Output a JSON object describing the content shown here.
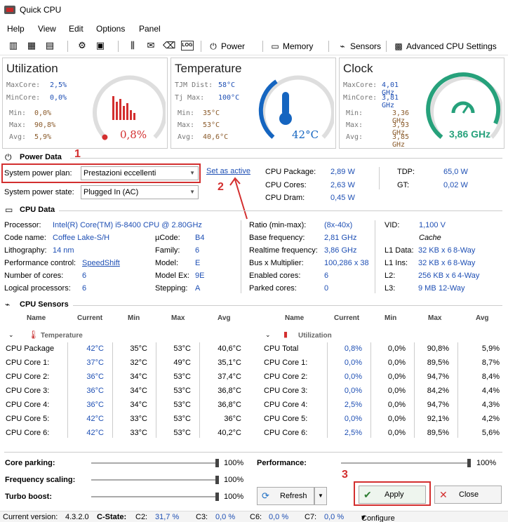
{
  "window": {
    "title": "Quick CPU"
  },
  "menu": [
    "Help",
    "View",
    "Edit",
    "Options",
    "Panel"
  ],
  "toolbar": {
    "power": "Power",
    "memory": "Memory",
    "sensors": "Sensors",
    "advanced": "Advanced CPU Settings",
    "log_icon": "LOG"
  },
  "utilization": {
    "title": "Utilization",
    "maxcore_label": "MaxCore:",
    "maxcore": "2,5%",
    "mincore_label": "MinCore:",
    "mincore": "0,0%",
    "min_label": "Min:",
    "min": "0,0%",
    "max_label": "Max:",
    "max": "90,8%",
    "avg_label": "Avg:",
    "avg": "5,9%",
    "value": "0,8%",
    "level": 0.008
  },
  "temperature": {
    "title": "Temperature",
    "tjm_label": "TJM Dist:",
    "tjm": "58°C",
    "tjmax_label": "Tj Max:",
    "tjmax": "100°C",
    "min_label": "Min:",
    "min": "35°C",
    "max_label": "Max:",
    "max": "53°C",
    "avg_label": "Avg:",
    "avg": "40,6°C",
    "value": "42°C",
    "level": 0.42
  },
  "clock": {
    "title": "Clock",
    "maxcore_label": "MaxCore:",
    "maxcore": "4,01 GHz",
    "mincore_label": "MinCore:",
    "mincore": "3,81 GHz",
    "min_label": "Min:",
    "min": "3,36 GHz",
    "max_label": "Max:",
    "max": "3,93 GHz",
    "avg_label": "Avg:",
    "avg": "3,85 GHz",
    "value": "3,86 GHz",
    "level": 0.9
  },
  "power_data": {
    "heading": "Power Data",
    "plan_label": "System power plan:",
    "plan_value": "Prestazioni eccellenti",
    "set_active": "Set as active",
    "state_label": "System power state:",
    "state_value": "Plugged In (AC)",
    "pkg_label": "CPU Package:",
    "pkg": "2,89 W",
    "cores_label": "CPU Cores:",
    "cores": "2,63 W",
    "dram_label": "CPU Dram:",
    "dram": "0,45 W",
    "tdp_label": "TDP:",
    "tdp": "65,0 W",
    "gt_label": "GT:",
    "gt": "0,02 W"
  },
  "annotations": {
    "one": "1",
    "two": "2",
    "three": "3"
  },
  "cpu_data": {
    "heading": "CPU Data",
    "processor_label": "Processor:",
    "processor": "Intel(R) Core(TM) i5-8400 CPU @ 2.80GHz",
    "codename_label": "Code name:",
    "codename": "Coffee Lake-S/H",
    "litho_label": "Lithography:",
    "litho": "14 nm",
    "perf_label": "Performance control:",
    "perf": "SpeedShift",
    "ncores_label": "Number of cores:",
    "ncores": "6",
    "nlogical_label": "Logical processors:",
    "nlogical": "6",
    "ucode_label": "µCode:",
    "ucode": "B4",
    "family_label": "Family:",
    "family": "6",
    "model_label": "Model:",
    "model": "E",
    "modelex_label": "Model Ex:",
    "modelex": "9E",
    "stepping_label": "Stepping:",
    "stepping": "A",
    "ratio_label": "Ratio (min-max):",
    "ratio": "(8x-40x)",
    "basefreq_label": "Base frequency:",
    "basefreq": "2,81 GHz",
    "rtfreq_label": "Realtime frequency:",
    "rtfreq": "3,86 GHz",
    "bus_label": "Bus x Multiplier:",
    "bus": "100,286 x 38",
    "enabled_label": "Enabled cores:",
    "enabled": "6",
    "parked_label": "Parked cores:",
    "parked": "0",
    "vid_label": "VID:",
    "vid": "1,100 V",
    "cache_label": "Cache",
    "l1d_label": "L1 Data:",
    "l1d": "32 KB x 6",
    "l1d_way": "8-Way",
    "l1i_label": "L1 Ins:",
    "l1i": "32 KB x 6",
    "l1i_way": "8-Way",
    "l2_label": "L2:",
    "l2": "256 KB x 6",
    "l2_way": "4-Way",
    "l3_label": "L3:",
    "l3": "9 MB",
    "l3_way": "12-Way"
  },
  "sensors": {
    "heading": "CPU Sensors",
    "cols": [
      "Name",
      "Current",
      "Min",
      "Max",
      "Avg"
    ],
    "temp_group": "Temperature",
    "util_group": "Utilization",
    "temp_rows": [
      [
        "CPU Package",
        "42°C",
        "35°C",
        "53°C",
        "40,6°C"
      ],
      [
        "CPU Core 1:",
        "37°C",
        "32°C",
        "49°C",
        "35,1°C"
      ],
      [
        "CPU Core 2:",
        "36°C",
        "34°C",
        "53°C",
        "37,4°C"
      ],
      [
        "CPU Core 3:",
        "36°C",
        "34°C",
        "53°C",
        "36,8°C"
      ],
      [
        "CPU Core 4:",
        "36°C",
        "34°C",
        "53°C",
        "36,8°C"
      ],
      [
        "CPU Core 5:",
        "42°C",
        "33°C",
        "53°C",
        "36°C"
      ],
      [
        "CPU Core 6:",
        "42°C",
        "33°C",
        "53°C",
        "40,2°C"
      ]
    ],
    "util_rows": [
      [
        "CPU Total",
        "0,8%",
        "0,0%",
        "90,8%",
        "5,9%"
      ],
      [
        "CPU Core 1:",
        "0,0%",
        "0,0%",
        "89,5%",
        "8,7%"
      ],
      [
        "CPU Core 2:",
        "0,0%",
        "0,0%",
        "94,7%",
        "8,4%"
      ],
      [
        "CPU Core 3:",
        "0,0%",
        "0,0%",
        "84,2%",
        "4,4%"
      ],
      [
        "CPU Core 4:",
        "2,5%",
        "0,0%",
        "94,7%",
        "4,3%"
      ],
      [
        "CPU Core 5:",
        "0,0%",
        "0,0%",
        "92,1%",
        "4,2%"
      ],
      [
        "CPU Core 6:",
        "2,5%",
        "0,0%",
        "89,5%",
        "5,6%"
      ]
    ]
  },
  "controls": {
    "core_parking": "Core parking:",
    "core_parking_val": "100%",
    "core_parking_level": 1.0,
    "freq_scaling": "Frequency scaling:",
    "freq_scaling_val": "100%",
    "freq_scaling_level": 1.0,
    "turbo": "Turbo boost:",
    "turbo_val": "100%",
    "turbo_level": 1.0,
    "performance": "Performance:",
    "performance_val": "100%",
    "performance_level": 1.0,
    "refresh": "Refresh",
    "apply": "Apply",
    "close": "Close"
  },
  "statusbar": {
    "version_label": "Current version:",
    "version": "4.3.2.0",
    "cstate_label": "C-State:",
    "c2_label": "C2:",
    "c2": "31,7 %",
    "c3_label": "C3:",
    "c3": "0,0 %",
    "c6_label": "C6:",
    "c6": "0,0 %",
    "c7_label": "C7:",
    "c7": "0,0 %",
    "configure": "Configure"
  },
  "colors": {
    "util_gauge": "#d32f2f",
    "temp_gauge": "#1565c0",
    "clock_gauge": "#26a17b",
    "annotation": "#d32f2f"
  }
}
